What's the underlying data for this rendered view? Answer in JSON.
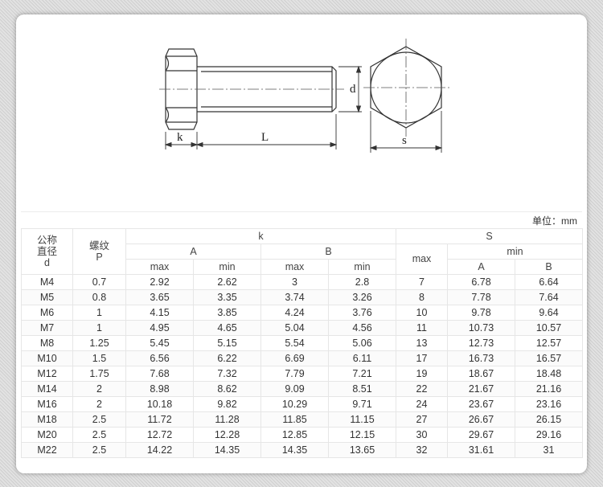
{
  "drawing": {
    "label_k": "k",
    "label_L": "L",
    "label_d": "d",
    "label_s": "s"
  },
  "unit_text": "单位：mm",
  "table": {
    "head": {
      "d_line1": "公称",
      "d_line2": "直径",
      "d_line3": "d",
      "p_line1": "螺纹",
      "p_line2": "P",
      "k": "k",
      "s": "S",
      "grade_a": "A",
      "grade_b": "B",
      "max": "max",
      "min": "min",
      "s_max": "max",
      "s_min": "min",
      "s_a": "A",
      "s_b": "B"
    },
    "rows": [
      [
        "M4",
        "0.7",
        "2.92",
        "2.62",
        "3",
        "2.8",
        "7",
        "6.78",
        "6.64"
      ],
      [
        "M5",
        "0.8",
        "3.65",
        "3.35",
        "3.74",
        "3.26",
        "8",
        "7.78",
        "7.64"
      ],
      [
        "M6",
        "1",
        "4.15",
        "3.85",
        "4.24",
        "3.76",
        "10",
        "9.78",
        "9.64"
      ],
      [
        "M7",
        "1",
        "4.95",
        "4.65",
        "5.04",
        "4.56",
        "11",
        "10.73",
        "10.57"
      ],
      [
        "M8",
        "1.25",
        "5.45",
        "5.15",
        "5.54",
        "5.06",
        "13",
        "12.73",
        "12.57"
      ],
      [
        "M10",
        "1.5",
        "6.56",
        "6.22",
        "6.69",
        "6.11",
        "17",
        "16.73",
        "16.57"
      ],
      [
        "M12",
        "1.75",
        "7.68",
        "7.32",
        "7.79",
        "7.21",
        "19",
        "18.67",
        "18.48"
      ],
      [
        "M14",
        "2",
        "8.98",
        "8.62",
        "9.09",
        "8.51",
        "22",
        "21.67",
        "21.16"
      ],
      [
        "M16",
        "2",
        "10.18",
        "9.82",
        "10.29",
        "9.71",
        "24",
        "23.67",
        "23.16"
      ],
      [
        "M18",
        "2.5",
        "11.72",
        "11.28",
        "11.85",
        "11.15",
        "27",
        "26.67",
        "26.15"
      ],
      [
        "M20",
        "2.5",
        "12.72",
        "12.28",
        "12.85",
        "12.15",
        "30",
        "29.67",
        "29.16"
      ],
      [
        "M22",
        "2.5",
        "14.22",
        "14.35",
        "14.35",
        "13.65",
        "32",
        "31.61",
        "31"
      ]
    ]
  }
}
